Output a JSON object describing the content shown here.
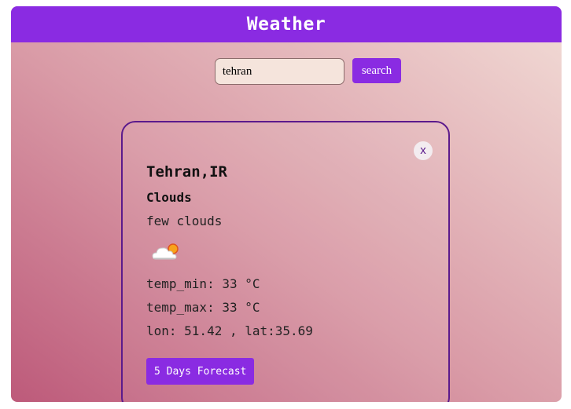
{
  "header": {
    "title": "Weather"
  },
  "search": {
    "value": "tehran",
    "button_label": "search"
  },
  "card": {
    "close_label": "x",
    "city": "Tehran,IR",
    "main": "Clouds",
    "description": "few clouds",
    "icon": "few-clouds-icon",
    "temp_min": "temp_min: 33 °C",
    "temp_max": "temp_max: 33 °C",
    "coords": "lon: 51.42 , lat:35.69",
    "forecast_label": "5 Days Forecast"
  },
  "colors": {
    "accent": "#8a2be2",
    "card_border": "#5b1a8c",
    "gradient_start": "#bd5a7a",
    "gradient_end": "#f2dcd6"
  }
}
